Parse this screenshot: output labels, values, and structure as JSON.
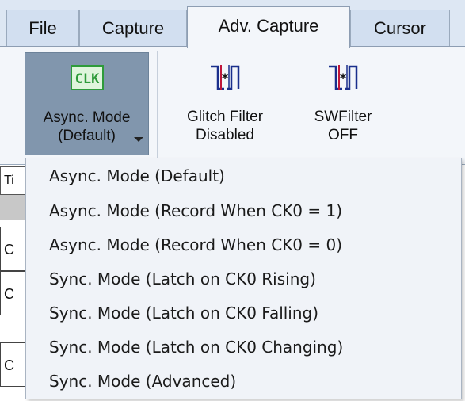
{
  "tabs": [
    {
      "label": "File",
      "active": false
    },
    {
      "label": "Capture",
      "active": false
    },
    {
      "label": "Adv. Capture",
      "active": true
    },
    {
      "label": "Cursor",
      "active": false
    }
  ],
  "ribbon": {
    "async_mode": {
      "icon_text": "CLK",
      "label": "Async. Mode\n(Default)",
      "pressed": true
    },
    "glitch_filter": {
      "label": "Glitch Filter\nDisabled"
    },
    "sw_filter": {
      "label": "SWFilter\nOFF"
    }
  },
  "grid": {
    "header": "Ti",
    "cells": [
      "C",
      "C",
      "C"
    ]
  },
  "menu": {
    "items": [
      "Async. Mode (Default)",
      "Async. Mode (Record When CK0 = 1)",
      "Async. Mode (Record When CK0 = 0)",
      "Sync. Mode (Latch on CK0 Rising)",
      "Sync. Mode (Latch on CK0 Falling)",
      "Sync. Mode (Latch on CK0 Changing)",
      "Sync. Mode (Advanced)"
    ]
  },
  "colors": {
    "ribbon_bg": "#f3f6fa",
    "tabstrip_bg": "#dde7f3",
    "pressed_button": "#8196ad",
    "clk_icon": "#2e9b3a",
    "filter_icon": "#1a2f8c",
    "filter_marker": "#c0163a"
  }
}
